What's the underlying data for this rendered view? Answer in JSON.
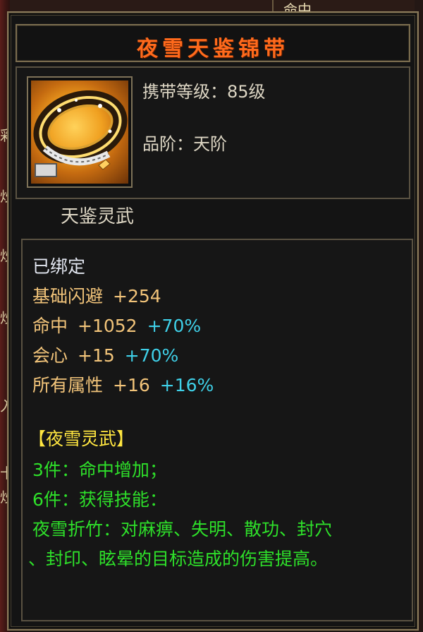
{
  "background": {
    "top_right_text": "命中",
    "left_glyphs": [
      "彩",
      "炒",
      "炒",
      "炒",
      "入",
      "卡",
      "炒"
    ]
  },
  "item": {
    "name": "夜雪天鉴锦带",
    "icon": "golden-belt-icon",
    "carry_level": "携带等级：85级",
    "grade": "品阶：天阶",
    "set_label": "天鉴灵武"
  },
  "attributes": {
    "bound": "已绑定",
    "stats": [
      {
        "name": "基础闪避",
        "value": "+254",
        "pct": ""
      },
      {
        "name": "命中",
        "value": "+1052",
        "pct": "+70%"
      },
      {
        "name": "会心",
        "value": "+15",
        "pct": "+70%"
      },
      {
        "name": "所有属性",
        "value": "+16",
        "pct": "+16%"
      }
    ],
    "set_title": "【夜雪灵武】",
    "set_bonus_3": "3件：命中增加；",
    "set_bonus_6": "6件：获得技能：",
    "skill_line_1": "夜雪折竹：对麻痹、失明、散功、封穴",
    "skill_line_2": "、封印、眩晕的目标造成的伤害提高。"
  },
  "colors": {
    "title": "#ff6a1c",
    "stat": "#f2c47a",
    "percent": "#3fd0e8",
    "set_title": "#ffe640",
    "set_bonus": "#2ee02a",
    "bound": "#e2e6f0"
  }
}
